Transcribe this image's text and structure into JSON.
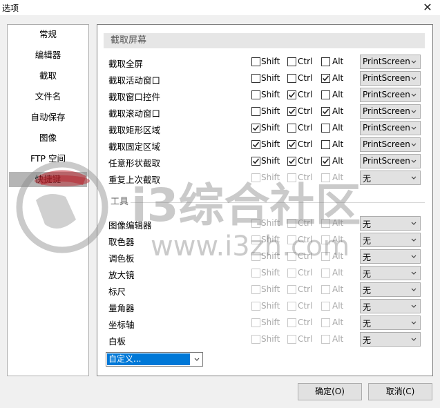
{
  "window": {
    "title": "选项"
  },
  "nav": {
    "items": [
      {
        "label": "常规"
      },
      {
        "label": "编辑器"
      },
      {
        "label": "截取"
      },
      {
        "label": "文件名"
      },
      {
        "label": "自动保存"
      },
      {
        "label": "图像"
      },
      {
        "label": "FTP 空间"
      },
      {
        "label": "快捷键",
        "selected": true
      }
    ]
  },
  "sections": {
    "capture": "截取屏幕",
    "tools": "工具"
  },
  "modifier_labels": {
    "shift": "Shift",
    "ctrl": "Ctrl",
    "alt": "Alt"
  },
  "capture_rows": [
    {
      "label": "截取全屏",
      "shift": false,
      "ctrl": false,
      "alt": false,
      "key": "PrintScreen",
      "enabled": true
    },
    {
      "label": "截取活动窗口",
      "shift": false,
      "ctrl": false,
      "alt": true,
      "key": "PrintScreen",
      "enabled": true
    },
    {
      "label": "截取窗口控件",
      "shift": false,
      "ctrl": true,
      "alt": false,
      "key": "PrintScreen",
      "enabled": true
    },
    {
      "label": "截取滚动窗口",
      "shift": false,
      "ctrl": true,
      "alt": true,
      "key": "PrintScreen",
      "enabled": true
    },
    {
      "label": "截取矩形区域",
      "shift": true,
      "ctrl": false,
      "alt": false,
      "key": "PrintScreen",
      "enabled": true
    },
    {
      "label": "截取固定区域",
      "shift": true,
      "ctrl": true,
      "alt": false,
      "key": "PrintScreen",
      "enabled": true
    },
    {
      "label": "任意形状截取",
      "shift": true,
      "ctrl": true,
      "alt": true,
      "key": "PrintScreen",
      "enabled": true
    },
    {
      "label": "重复上次截取",
      "shift": false,
      "ctrl": false,
      "alt": false,
      "key": "无",
      "enabled": false
    }
  ],
  "tool_rows": [
    {
      "label": "图像编辑器",
      "key": "无"
    },
    {
      "label": "取色器",
      "key": "无"
    },
    {
      "label": "调色板",
      "key": "无"
    },
    {
      "label": "放大镜",
      "key": "无"
    },
    {
      "label": "标尺",
      "key": "无"
    },
    {
      "label": "量角器",
      "key": "无"
    },
    {
      "label": "坐标轴",
      "key": "无"
    },
    {
      "label": "白板",
      "key": "无"
    }
  ],
  "custom_combo": {
    "value": "自定义..."
  },
  "buttons": {
    "ok": "确定(O)",
    "cancel": "取消(C)"
  },
  "watermark": {
    "line1": "i3综合社区",
    "line2": "www.i3zh.com"
  }
}
